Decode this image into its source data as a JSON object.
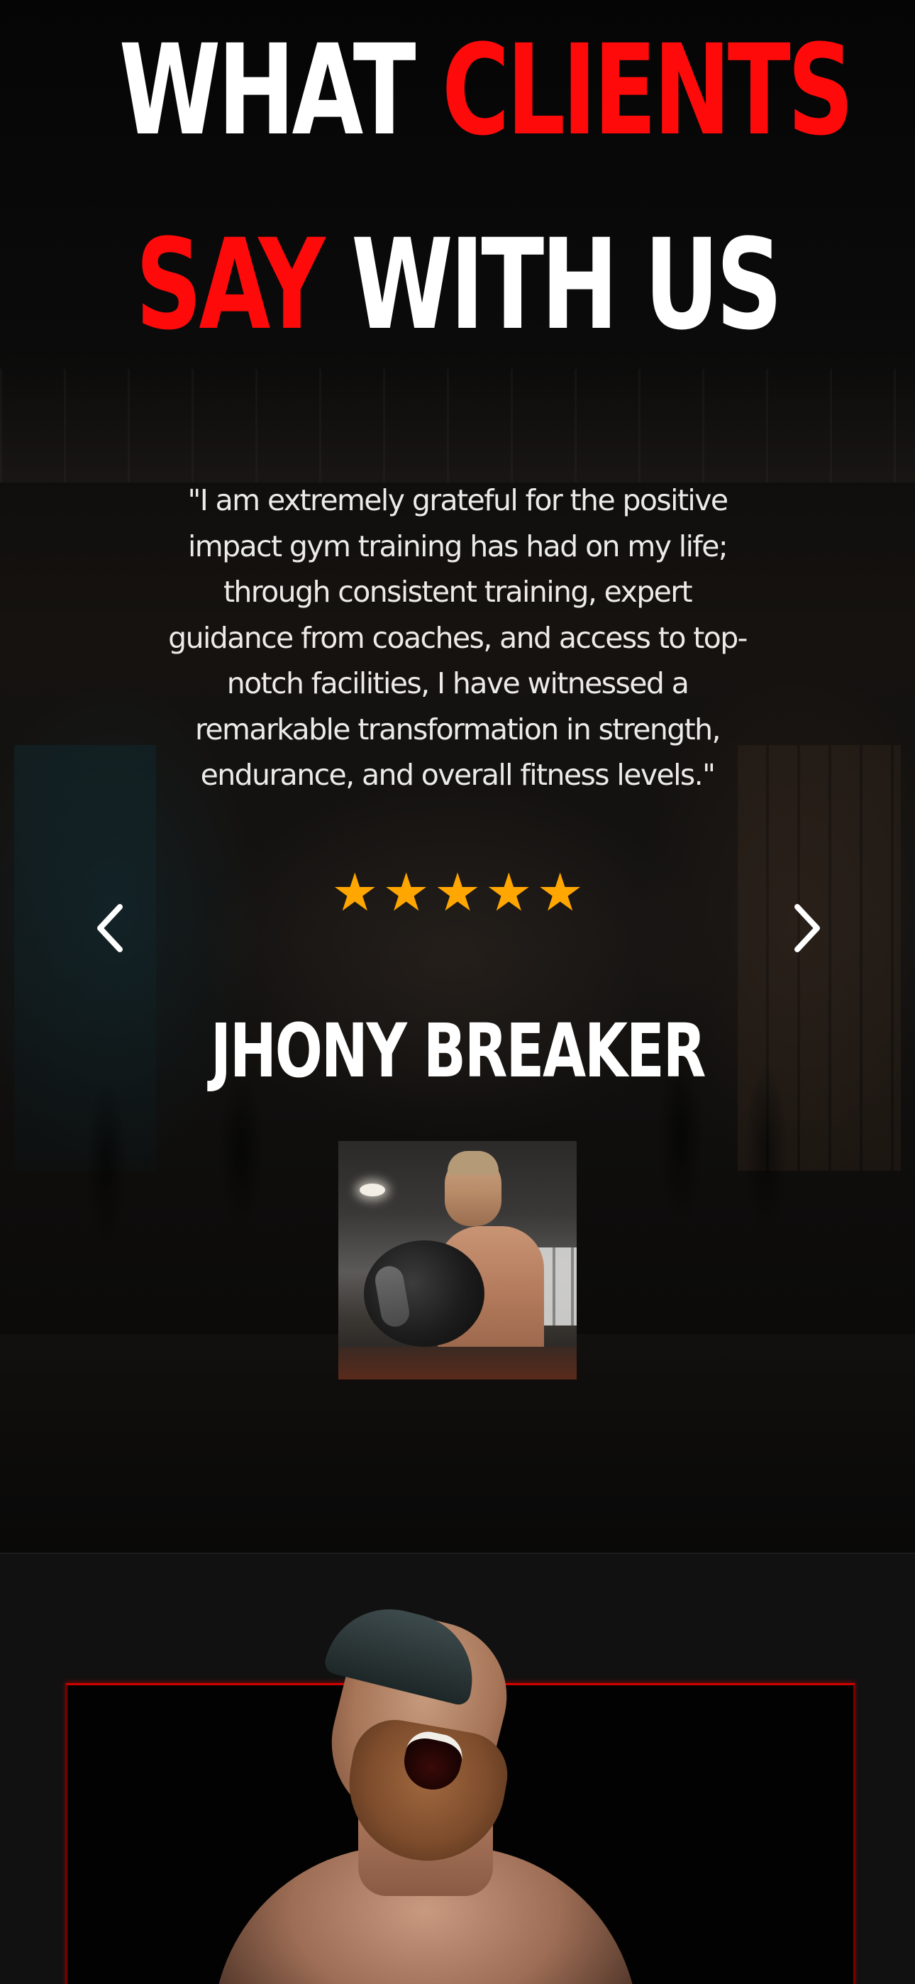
{
  "testimonials": {
    "heading": {
      "line1_white": "WHAT ",
      "line1_red": "CLIENTS",
      "line2_red": "SAY",
      "line2_white": " WITH US"
    },
    "quote": "\"I am extremely grateful for the positive impact gym training has had on my life; through consistent training, expert guidance from coaches, and access to top-notch facilities, I have witnessed a remarkable transformation in strength, endurance, and overall fitness levels.\"",
    "rating": {
      "stars": 5,
      "max": 5,
      "star_glyph": "★",
      "star_color": "#ffa600"
    },
    "client_name": "JHONY BREAKER",
    "client_photo": "client-photo-man-lifting-kettlebell",
    "nav": {
      "prev_icon": "chevron-left-icon",
      "next_icon": "chevron-right-icon"
    },
    "colors": {
      "accent": "#ff0a0a",
      "text": "#ffffff",
      "background": "#070707"
    }
  },
  "next_section": {
    "image": "laughing-bearded-man-photo",
    "box_border_color": "#d10000",
    "background": "#111111"
  }
}
